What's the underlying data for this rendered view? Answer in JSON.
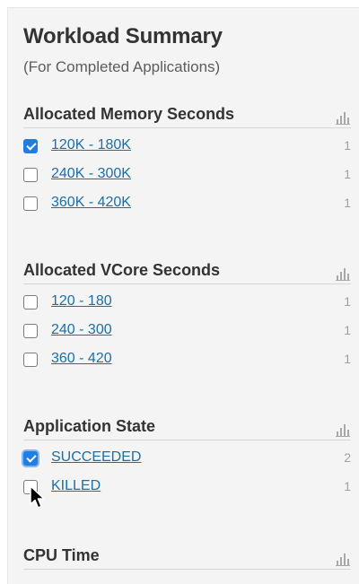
{
  "panel": {
    "title": "Workload Summary",
    "subtitle": "(For Completed Applications)"
  },
  "sections": [
    {
      "title": "Allocated Memory Seconds",
      "icon": "bar-chart-icon",
      "items": [
        {
          "label": "120K - 180K",
          "count": "1",
          "checked": true
        },
        {
          "label": "240K - 300K",
          "count": "1",
          "checked": false
        },
        {
          "label": "360K - 420K",
          "count": "1",
          "checked": false
        }
      ]
    },
    {
      "title": "Allocated VCore Seconds",
      "icon": "bar-chart-icon",
      "items": [
        {
          "label": "120 - 180",
          "count": "1",
          "checked": false
        },
        {
          "label": "240 - 300",
          "count": "1",
          "checked": false
        },
        {
          "label": "360 - 420",
          "count": "1",
          "checked": false
        }
      ]
    },
    {
      "title": "Application State",
      "icon": "bar-chart-icon",
      "items": [
        {
          "label": "SUCCEEDED",
          "count": "2",
          "checked": true
        },
        {
          "label": "KILLED",
          "count": "1",
          "checked": false
        }
      ]
    },
    {
      "title": "CPU Time",
      "icon": "bar-chart-icon",
      "items": []
    }
  ],
  "colors": {
    "link": "#1a6fa8",
    "checkbox_checked": "#1f7ee0",
    "panel_bg": "#f4f4f4"
  }
}
